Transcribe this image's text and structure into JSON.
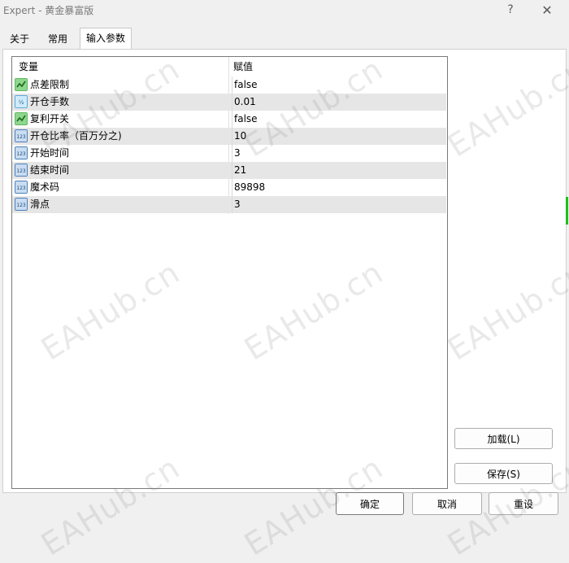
{
  "window": {
    "title": "Expert - 黄金暴富版",
    "help_icon": "?",
    "close_icon": "✕"
  },
  "tabs": [
    {
      "label": "关于",
      "active": false
    },
    {
      "label": "常用",
      "active": false
    },
    {
      "label": "输入参数",
      "active": true
    }
  ],
  "grid": {
    "headers": {
      "name": "变量",
      "value": "赋值"
    },
    "rows": [
      {
        "icon": "bool-icon",
        "name": "点差限制",
        "value": "false"
      },
      {
        "icon": "double-icon",
        "name": "开仓手数",
        "value": "0.01"
      },
      {
        "icon": "bool-icon",
        "name": "复利开关",
        "value": "false"
      },
      {
        "icon": "int-icon",
        "name": "开仓比率（百万分之)",
        "value": "10"
      },
      {
        "icon": "int-icon",
        "name": "开始时间",
        "value": "3"
      },
      {
        "icon": "int-icon",
        "name": "结束时间",
        "value": "21"
      },
      {
        "icon": "int-icon",
        "name": "魔术码",
        "value": "89898"
      },
      {
        "icon": "int-icon",
        "name": "滑点",
        "value": "3"
      }
    ]
  },
  "side_buttons": {
    "load": "加载(L)",
    "save": "保存(S)"
  },
  "footer_buttons": {
    "ok": "确定",
    "cancel": "取消",
    "reset": "重设"
  },
  "watermark_text": "EAHub.cn"
}
